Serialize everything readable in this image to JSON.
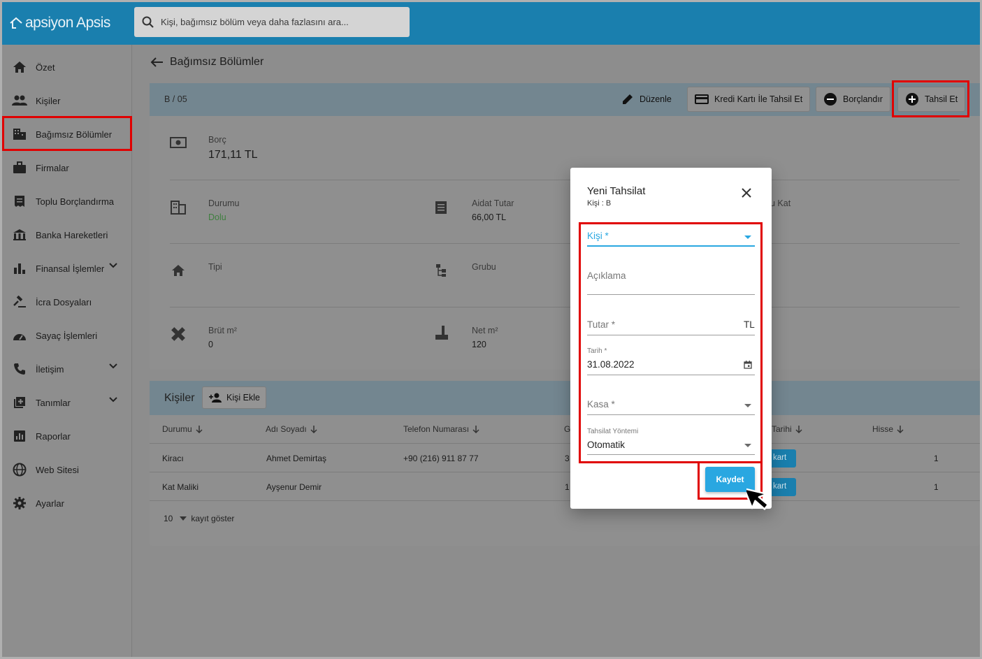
{
  "app": {
    "logo_text": "apsiyon Apsis",
    "search_placeholder": "Kişi, bağımsız bölüm veya daha fazlasını ara..."
  },
  "sidebar": {
    "items": [
      {
        "label": "Özet",
        "icon": "home-icon"
      },
      {
        "label": "Kişiler",
        "icon": "people-icon"
      },
      {
        "label": "Bağımsız Bölümler",
        "icon": "building-icon"
      },
      {
        "label": "Firmalar",
        "icon": "briefcase-icon"
      },
      {
        "label": "Toplu Borçlandırma",
        "icon": "receipt-icon"
      },
      {
        "label": "Banka Hareketleri",
        "icon": "bank-icon"
      },
      {
        "label": "Finansal İşlemler",
        "icon": "bar-chart-icon"
      },
      {
        "label": "İcra Dosyaları",
        "icon": "gavel-icon"
      },
      {
        "label": "Sayaç İşlemleri",
        "icon": "meter-icon"
      },
      {
        "label": "İletişim",
        "icon": "phone-icon"
      },
      {
        "label": "Tanımlar",
        "icon": "library-add-icon"
      },
      {
        "label": "Raporlar",
        "icon": "report-icon"
      },
      {
        "label": "Web Sitesi",
        "icon": "globe-icon"
      },
      {
        "label": "Ayarlar",
        "icon": "gear-icon"
      }
    ]
  },
  "page": {
    "title": "Bağımsız Bölümler"
  },
  "unit": {
    "code": "B / 05",
    "actions": {
      "edit": "Düzenle",
      "card": "Kredi Kartı İle Tahsil Et",
      "debit": "Borçlandır",
      "collect": "Tahsil Et"
    },
    "debt_label": "Borç",
    "debt_value": "171,11 TL",
    "status_label": "Durumu",
    "status_value": "Dolu",
    "dues_label": "Aidat Tutar",
    "dues_value": "66,00 TL",
    "floor_label_partial": "u Kat",
    "type_label": "Tipi",
    "group_label": "Grubu",
    "gross_label": "Brüt m²",
    "gross_value": "0",
    "net_label": "Net m²",
    "net_value": "120"
  },
  "people": {
    "title": "Kişiler",
    "add_button": "Kişi Ekle",
    "columns": [
      "Durumu",
      "Adı Soyadı",
      "Telefon Numarası",
      "G",
      "Tarihi",
      "Hisse"
    ],
    "rows": [
      {
        "status": "Kiracı",
        "name": "Ahmet Demirtaş",
        "phone": "+90 (216) 911 87 77",
        "g": "3",
        "btn": "kart",
        "share": "1"
      },
      {
        "status": "Kat Maliki",
        "name": "Ayşenur Demir",
        "phone": "",
        "g": "1",
        "btn": "kart",
        "share": "1"
      }
    ],
    "page_size": "10",
    "page_size_label": "kayıt göster"
  },
  "modal": {
    "title": "Yeni Tahsilat",
    "subtitle": "Kişi : B",
    "person_label": "Kişi *",
    "description_label": "Açıklama",
    "amount_label": "Tutar *",
    "currency": "TL",
    "date_label": "Tarih *",
    "date_value": "31.08.2022",
    "cash_label": "Kasa *",
    "method_label": "Tahsilat Yöntemi",
    "method_value": "Otomatik",
    "save_button": "Kaydet"
  },
  "colors": {
    "topbar": "#1a7fae",
    "accent": "#29a7e1",
    "highlight": "#e00000",
    "status_ok": "#3f7f3f"
  }
}
